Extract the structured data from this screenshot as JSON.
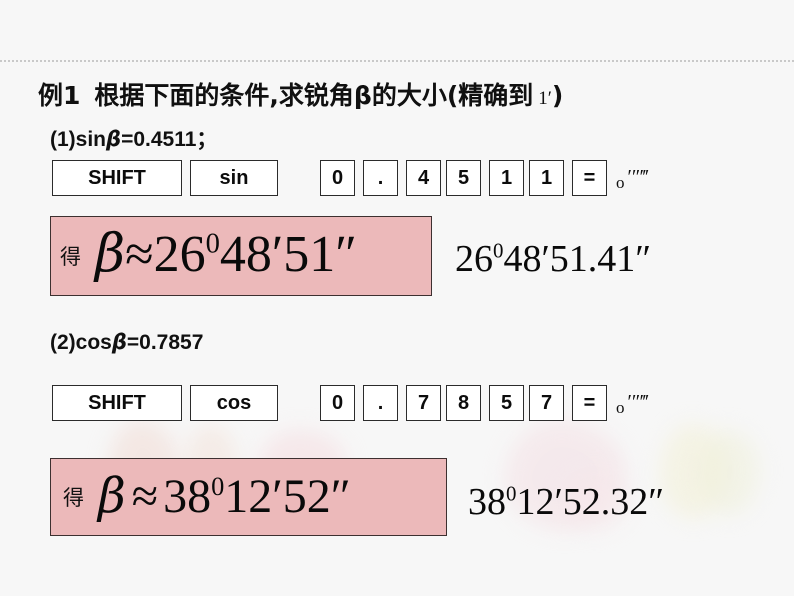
{
  "slide": {
    "background_color": "#f7f7f7",
    "accent_color": "#ecb9ba",
    "title": {
      "example_label": "例1",
      "text_before_beta": "根据下面的条件,求锐角",
      "beta": "β",
      "text_after_beta": "的大小(精确到",
      "precision_value": "1",
      "precision_unit": "′",
      "close_paren": ")"
    },
    "problems": [
      {
        "number": "(1)",
        "function": "sin",
        "variable": "β",
        "equals": "=",
        "value": "0.4511",
        "terminator": "；",
        "keys": [
          "SHIFT",
          "sin",
          "0",
          ".",
          "4",
          "5",
          "1",
          "1",
          "="
        ],
        "dms_key_base": "o",
        "dms_key_primes": "′″‴",
        "result_prefix": "得",
        "result_beta": "β",
        "result_approx": "≈",
        "result_degrees": "26",
        "result_deg_symbol": "0",
        "result_minutes": "48",
        "result_min_symbol": "′",
        "result_seconds": "51",
        "result_sec_symbol": "″",
        "exact_degrees": "26",
        "exact_deg_symbol": "0",
        "exact_minutes": "48",
        "exact_min_symbol": "′",
        "exact_seconds": "51.41",
        "exact_sec_symbol": "″"
      },
      {
        "number": "(2)",
        "function": "cos",
        "variable": "β",
        "equals": "=",
        "value": "0.7857",
        "terminator": "",
        "keys": [
          "SHIFT",
          "cos",
          "0",
          ".",
          "7",
          "8",
          "5",
          "7",
          "="
        ],
        "dms_key_base": "o",
        "dms_key_primes": "′″‴",
        "result_prefix": "得",
        "result_beta": "β",
        "result_approx": "≈",
        "result_degrees": "38",
        "result_deg_symbol": "0",
        "result_minutes": "12",
        "result_min_symbol": "′",
        "result_seconds": "52",
        "result_sec_symbol": "″",
        "exact_degrees": "38",
        "exact_deg_symbol": "0",
        "exact_minutes": "12",
        "exact_min_symbol": "′",
        "exact_seconds": "52.32",
        "exact_sec_symbol": "″"
      }
    ]
  }
}
